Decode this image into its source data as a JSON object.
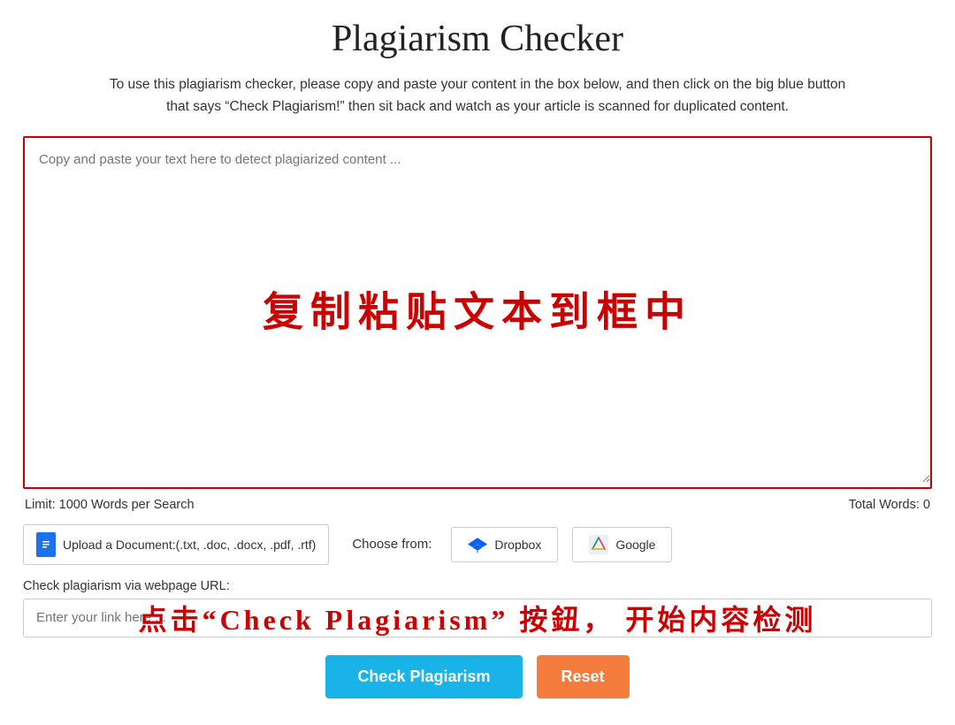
{
  "page": {
    "title": "Plagiarism Checker",
    "description_line1": "To use this plagiarism checker, please copy and paste your content in the box below, and then click on the big blue button",
    "description_line2": "that says “Check Plagiarism!” then sit back and watch as your article is scanned for duplicated content."
  },
  "textarea": {
    "placeholder": "Copy and paste your text here to detect plagiarized content ...",
    "chinese_text": "复制粘贴文本到框中"
  },
  "word_count": {
    "limit_label": "Limit: 1000 Words per Search",
    "total_label": "Total Words: 0"
  },
  "upload": {
    "button_label": "Upload a Document:(.txt, .doc, .docx, .pdf, .rtf)",
    "choose_from_label": "Choose from:",
    "dropbox_label": "Dropbox",
    "google_label": "Google"
  },
  "url_section": {
    "label": "Check plagiarism via webpage URL:",
    "placeholder": "Enter your link here ...",
    "chinese_text": "点击“Check Plagiarism” 按鈕， 开始内容检测"
  },
  "buttons": {
    "check_label": "Check Plagiarism",
    "reset_label": "Reset"
  }
}
